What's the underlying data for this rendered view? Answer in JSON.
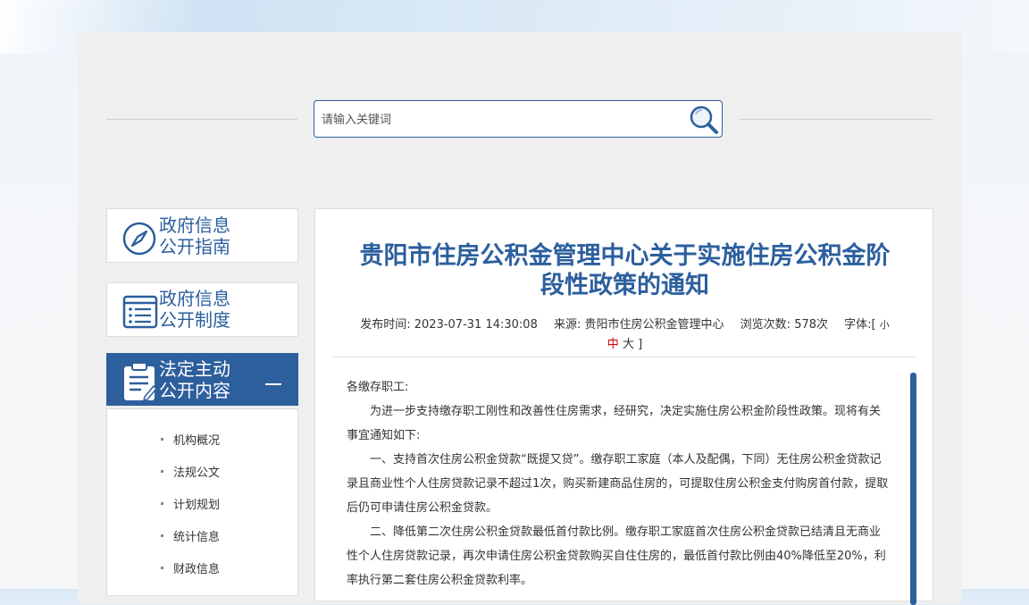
{
  "search": {
    "placeholder": "请输入关键词"
  },
  "nav": [
    {
      "line1": "政府信息",
      "line2": "公开指南",
      "icon": "compass-icon"
    },
    {
      "line1": "政府信息",
      "line2": "公开制度",
      "icon": "list-icon"
    },
    {
      "line1": "法定主动",
      "line2": "公开内容",
      "icon": "clipboard-icon",
      "active": true
    }
  ],
  "sub_menu": [
    "机构概况",
    "法规公文",
    "计划规划",
    "统计信息",
    "财政信息"
  ],
  "article": {
    "title_line1": "贵阳市住房公积金管理中心关于实施住房公积金阶",
    "title_line2": "段性政策的通知",
    "publish_label": "发布时间:",
    "publish_time": "2023-07-31 14:30:08",
    "source_label": "来源:",
    "source": "贵阳市住房公积金管理中心",
    "views_label": "浏览次数:",
    "views": "578次",
    "font_label": "字体:[",
    "font_small": "小",
    "font_mid": "中",
    "font_large": "大",
    "font_close": "]",
    "greeting": "各缴存职工:",
    "para1": "为进一步支持缴存职工刚性和改善性住房需求，经研究，决定实施住房公积金阶段性政策。现将有关事宜通知如下:",
    "para2": "一、支持首次住房公积金贷款“既提又贷”。缴存职工家庭（本人及配偶，下同）无住房公积金贷款记录且商业性个人住房贷款记录不超过1次，购买新建商品住房的，可提取住房公积金支付购房首付款，提取后仍可申请住房公积金贷款。",
    "para3": "二、降低第二次住房公积金贷款最低首付款比例。缴存职工家庭首次住房公积金贷款已结清且无商业性个人住房贷款记录，再次申请住房公积金贷款购买自住住房的，最低首付款比例由40%降低至20%，利率执行第二套住房公积金贷款利率。"
  }
}
